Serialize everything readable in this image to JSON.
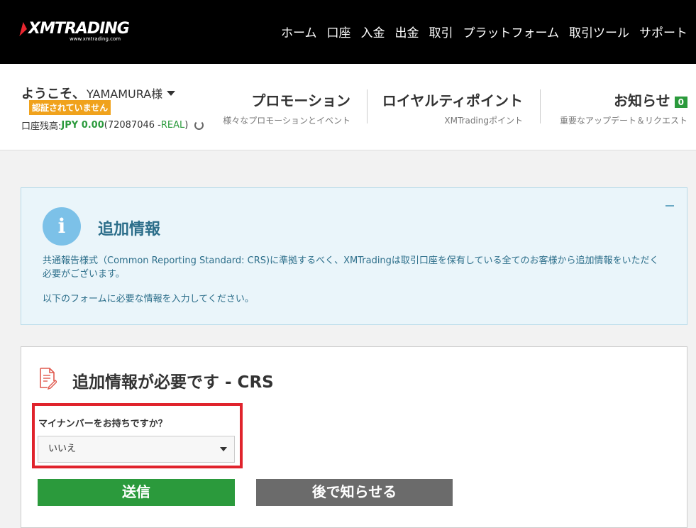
{
  "brand": {
    "logo_text": "XMTRADING",
    "logo_url_text": "www.xmtrading.com",
    "accent_color": "#e8262f"
  },
  "nav": {
    "items": [
      {
        "label": "ホーム"
      },
      {
        "label": "口座"
      },
      {
        "label": "入金"
      },
      {
        "label": "出金"
      },
      {
        "label": "取引"
      },
      {
        "label": "プラットフォーム"
      },
      {
        "label": "取引ツール"
      },
      {
        "label": "サポート"
      }
    ]
  },
  "account": {
    "welcome": "ようこそ、",
    "username": "YAMAMURA様",
    "status_badge": "認証されていません",
    "balance_label": "口座残高: ",
    "balance_value": "JPY 0.00",
    "account_open": " (72087046 - ",
    "account_type": "REAL",
    "account_close": ")"
  },
  "header_links": {
    "promotion": {
      "title": "プロモーション",
      "sub": "様々なプロモーションとイベント"
    },
    "loyalty": {
      "title": "ロイヤルティポイント",
      "sub": "XMTradingポイント"
    },
    "news": {
      "title": "お知らせ",
      "count": "0",
      "sub": "重要なアップデート＆リクエスト"
    }
  },
  "info_panel": {
    "title": "追加情報",
    "icon": "info-icon",
    "text1": "共通報告様式（Common Reporting Standard: CRS)に準拠するべく、XMTradingは取引口座を保有している全てのお客様から追加情報をいただく必要がございます。",
    "text2": "以下のフォームに必要な情報を入力してください。"
  },
  "form": {
    "title": "追加情報が必要です - CRS",
    "question": "マイナンバーをお持ちですか？",
    "selected_value": "いいえ",
    "submit_label": "送信",
    "later_label": "後で知らせる"
  },
  "colors": {
    "green": "#2b9a3c",
    "badge_orange": "#f0a21c",
    "highlight_red": "#e0232c",
    "info_bg": "#eaf5fa"
  }
}
